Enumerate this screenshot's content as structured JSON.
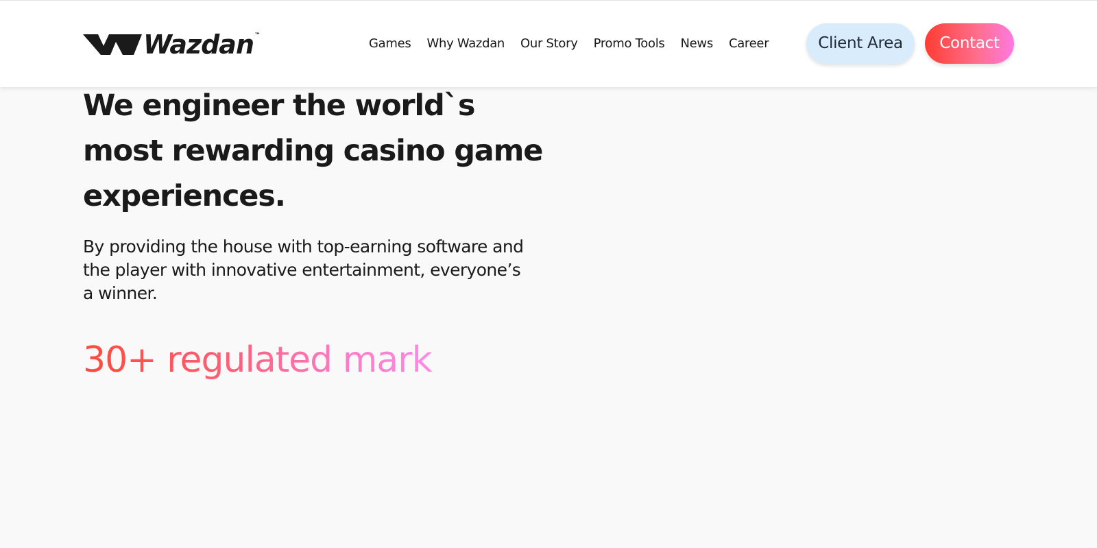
{
  "header": {
    "logo": {
      "text": "Wazdan",
      "tm": "™",
      "icon": "wazdan-logo-icon"
    },
    "nav": [
      {
        "label": "Games"
      },
      {
        "label": "Why Wazdan"
      },
      {
        "label": "Our Story"
      },
      {
        "label": "Promo Tools"
      },
      {
        "label": "News"
      },
      {
        "label": "Career"
      }
    ],
    "client_area_label": "Client Area",
    "contact_label": "Contact"
  },
  "hero": {
    "title": "We engineer the world`s most rewarding casino game experiences.",
    "description": "By providing the house with top-earning software and the player with innovative entertainment, everyone’s a winner.",
    "stat": "30+ regulated mark"
  },
  "colors": {
    "background": "#f9f9f9",
    "header_bg": "#ffffff",
    "text": "#1a1a1a",
    "client_area_bg": "#d9ecfb",
    "contact_gradient_start": "#ff3d33",
    "contact_gradient_end": "#ff7ae0"
  }
}
